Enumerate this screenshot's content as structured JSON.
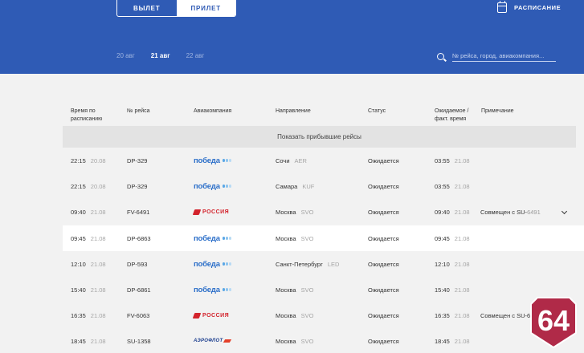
{
  "header": {
    "toggle": {
      "departure": "ВЫЛЕТ",
      "arrival": "ПРИЛЕТ"
    },
    "schedule_label": "РАСПИСАНИЕ",
    "dates": [
      "20 авг",
      "21 авг",
      "22 авг"
    ],
    "active_date_index": 1,
    "search_placeholder": "№ рейса, город, авиакомпания..."
  },
  "table": {
    "columns": [
      "Время по расписанию",
      "№ рейса",
      "Авиакомпания",
      "Направление",
      "Статус",
      "Ожидаемое / факт. время",
      "Примечание"
    ],
    "show_arrived_label": "Показать прибывшие рейсы",
    "rows": [
      {
        "time": "22:15",
        "date": "20.08",
        "flight": "DP-329",
        "airline": "pobeda",
        "airline_text": "победа",
        "city": "Сочи",
        "code": "AER",
        "status": "Ожидается",
        "exp_time": "03:55",
        "exp_date": "21.08",
        "note": "",
        "note_code": ""
      },
      {
        "time": "22:15",
        "date": "20.08",
        "flight": "DP-329",
        "airline": "pobeda",
        "airline_text": "победа",
        "city": "Самара",
        "code": "KUF",
        "status": "Ожидается",
        "exp_time": "03:55",
        "exp_date": "21.08",
        "note": "",
        "note_code": ""
      },
      {
        "time": "09:40",
        "date": "21.08",
        "flight": "FV-6491",
        "airline": "rossiya",
        "airline_text": "РОССИЯ",
        "city": "Москва",
        "code": "SVO",
        "status": "Ожидается",
        "exp_time": "09:40",
        "exp_date": "21.08",
        "note": "Совмещен с SU-",
        "note_code": "6491"
      },
      {
        "time": "09:45",
        "date": "21.08",
        "flight": "DP-6863",
        "airline": "pobeda",
        "airline_text": "победа",
        "city": "Москва",
        "code": "SVO",
        "status": "Ожидается",
        "exp_time": "09:45",
        "exp_date": "21.08",
        "note": "",
        "note_code": ""
      },
      {
        "time": "12:10",
        "date": "21.08",
        "flight": "DP-593",
        "airline": "pobeda",
        "airline_text": "победа",
        "city": "Санкт-Петербург",
        "code": "LED",
        "status": "Ожидается",
        "exp_time": "12:10",
        "exp_date": "21.08",
        "note": "",
        "note_code": ""
      },
      {
        "time": "15:40",
        "date": "21.08",
        "flight": "DP-6861",
        "airline": "pobeda",
        "airline_text": "победа",
        "city": "Москва",
        "code": "SVO",
        "status": "Ожидается",
        "exp_time": "15:40",
        "exp_date": "21.08",
        "note": "",
        "note_code": ""
      },
      {
        "time": "16:35",
        "date": "21.08",
        "flight": "FV-6063",
        "airline": "rossiya",
        "airline_text": "РОССИЯ",
        "city": "Москва",
        "code": "SVO",
        "status": "Ожидается",
        "exp_time": "16:35",
        "exp_date": "21.08",
        "note": "Совмещен с SU-6",
        "note_code": ""
      },
      {
        "time": "18:45",
        "date": "21.08",
        "flight": "SU-1358",
        "airline": "aeroflot",
        "airline_text": "АЭРОФЛОТ",
        "city": "Москва",
        "code": "SVO",
        "status": "Ожидается",
        "exp_time": "18:45",
        "exp_date": "21.08",
        "note": "",
        "note_code": ""
      }
    ]
  },
  "badge": {
    "text": "64"
  },
  "colors": {
    "header_bg": "#2f5bb5",
    "pobeda": "#2c6fc9",
    "rossiya": "#d3232c",
    "aeroflot": "#1d3f8f",
    "badge": "#b02a48"
  }
}
